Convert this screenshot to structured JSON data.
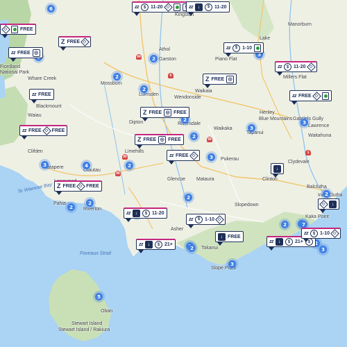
{
  "towns": [
    {
      "name": "Kingston"
    },
    {
      "name": "Manorburn"
    },
    {
      "name": "Lake"
    },
    {
      "name": "Athol"
    },
    {
      "name": "Garston"
    },
    {
      "name": "Piano Flat"
    },
    {
      "name": "Fiordland"
    },
    {
      "name": "National Park"
    },
    {
      "name": "Whare Creek"
    },
    {
      "name": "Mossburn"
    },
    {
      "name": "Lumsden"
    },
    {
      "name": "Waikaia"
    },
    {
      "name": "Wendonside"
    },
    {
      "name": "Millers Flat"
    },
    {
      "name": "Blackmount"
    },
    {
      "name": "Henley"
    },
    {
      "name": "Waiau"
    },
    {
      "name": "Blue Mountains"
    },
    {
      "name": "Gabriels Gully"
    },
    {
      "name": "Lawrence"
    },
    {
      "name": "Dipton"
    },
    {
      "name": "Riversdale"
    },
    {
      "name": "Waikaka"
    },
    {
      "name": "Tapanui"
    },
    {
      "name": "Waitahuna"
    },
    {
      "name": "Clifden"
    },
    {
      "name": "Limehills"
    },
    {
      "name": "Pukerau"
    },
    {
      "name": "Clydevale"
    },
    {
      "name": "Tuatapere"
    },
    {
      "name": "Otautau"
    },
    {
      "name": "Clinton"
    },
    {
      "name": "Balclutha"
    },
    {
      "name": "Longwood"
    },
    {
      "name": "Glencoe"
    },
    {
      "name": "Mataura"
    },
    {
      "name": "Inch Clutha"
    },
    {
      "name": "Pahia"
    },
    {
      "name": "Riverton"
    },
    {
      "name": "Slopedown"
    },
    {
      "name": "Kaka Point"
    },
    {
      "name": "Asher"
    },
    {
      "name": "Tokanui"
    },
    {
      "name": "Slope Point"
    },
    {
      "name": "Oban"
    },
    {
      "name": "Stewart Island"
    },
    {
      "name": "Stewart Island / Rakiura"
    }
  ],
  "water_labels": [
    {
      "name": "Te Waewae Bay"
    },
    {
      "name": "Foveaux Strait"
    }
  ],
  "road_numbers": [
    "94",
    "6",
    "90",
    "96",
    "99",
    "1"
  ],
  "clusters": [
    "6",
    "5",
    "2",
    "2",
    "2",
    "2",
    "2",
    "3",
    "3",
    "3",
    "3",
    "3",
    "2",
    "2",
    "2",
    "3",
    "4",
    "2",
    "5",
    "2",
    "5",
    "2",
    "3",
    "2",
    "2",
    "7",
    "2",
    "3"
  ],
  "badges": [
    {
      "parts": [
        {
          "t": "zz",
          "v": "zz"
        },
        {
          "t": "coin",
          "v": "$"
        },
        {
          "t": "text",
          "v": "11-20"
        },
        {
          "t": "diamond",
          "v": "◇"
        },
        {
          "t": "green"
        },
        {
          "t": "coinsq",
          "v": "$"
        }
      ],
      "magenta": true
    },
    {
      "parts": [
        {
          "t": "diamond",
          "v": "◇"
        },
        {
          "t": "green"
        },
        {
          "t": "text",
          "v": "FREE"
        }
      ],
      "magenta": true
    },
    {
      "parts": [
        {
          "t": "zz",
          "v": "zz"
        },
        {
          "t": "text",
          "v": "FREE"
        },
        {
          "t": "shower",
          "v": "◎"
        }
      ]
    },
    {
      "parts": [
        {
          "t": "z",
          "v": "Z"
        },
        {
          "t": "text",
          "v": "FREE"
        },
        {
          "t": "diamond",
          "v": "◇"
        }
      ],
      "magenta": true
    },
    {
      "parts": [
        {
          "t": "zz",
          "v": "zz"
        },
        {
          "t": "text",
          "v": "FREE"
        }
      ]
    },
    {
      "parts": [
        {
          "t": "zz",
          "v": "zz"
        },
        {
          "t": "drop",
          "v": "↓"
        },
        {
          "t": "coin",
          "v": "$"
        },
        {
          "t": "text",
          "v": "11-20"
        }
      ]
    },
    {
      "parts": [
        {
          "t": "zz",
          "v": "zz"
        },
        {
          "t": "coin",
          "v": "$"
        },
        {
          "t": "text",
          "v": "1-10"
        },
        {
          "t": "green"
        }
      ]
    },
    {
      "parts": [
        {
          "t": "zz",
          "v": "zz"
        },
        {
          "t": "coin",
          "v": "$"
        },
        {
          "t": "text",
          "v": "11-20"
        },
        {
          "t": "diamond",
          "v": "◇"
        }
      ],
      "magenta": true
    },
    {
      "parts": [
        {
          "t": "z",
          "v": "Z"
        },
        {
          "t": "text",
          "v": "FREE"
        },
        {
          "t": "shower",
          "v": "◎"
        },
        {
          "t": "text",
          "v": "FREE"
        }
      ]
    },
    {
      "parts": [
        {
          "t": "zz",
          "v": "zz"
        },
        {
          "t": "text",
          "v": "FREE"
        },
        {
          "t": "diamond",
          "v": "◇"
        },
        {
          "t": "green"
        }
      ]
    },
    {
      "parts": [
        {
          "t": "zz",
          "v": "zz"
        },
        {
          "t": "coin",
          "v": "$"
        },
        {
          "t": "text",
          "v": "1-10"
        },
        {
          "t": "diamond",
          "v": "◇"
        }
      ]
    },
    {
      "parts": [
        {
          "t": "z",
          "v": "Z"
        },
        {
          "t": "text",
          "v": "FREE"
        },
        {
          "t": "shower",
          "v": "◎"
        }
      ]
    },
    {
      "parts": [
        {
          "t": "zz",
          "v": "zz"
        },
        {
          "t": "text",
          "v": "FREE"
        },
        {
          "t": "diamond",
          "v": "◇"
        },
        {
          "t": "text",
          "v": "FREE"
        }
      ],
      "magenta": true
    },
    {
      "parts": [
        {
          "t": "z",
          "v": "Z"
        },
        {
          "t": "text",
          "v": "FREE"
        },
        {
          "t": "shower",
          "v": "◎"
        },
        {
          "t": "text",
          "v": "FREE"
        }
      ],
      "magenta": true
    },
    {
      "parts": [
        {
          "t": "zz",
          "v": "zz"
        },
        {
          "t": "text",
          "v": "FREE"
        },
        {
          "t": "diamond",
          "v": "◇"
        }
      ]
    },
    {
      "parts": [
        {
          "t": "drop",
          "v": "↓"
        }
      ]
    },
    {
      "parts": [
        {
          "t": "z",
          "v": "Z"
        },
        {
          "t": "text",
          "v": "FREE"
        },
        {
          "t": "diamond",
          "v": "◇"
        },
        {
          "t": "text",
          "v": "FREE"
        }
      ],
      "magenta": true
    },
    {
      "parts": [
        {
          "t": "diamond",
          "v": "◇"
        },
        {
          "t": "drop",
          "v": "↓"
        }
      ]
    },
    {
      "parts": [
        {
          "t": "zz",
          "v": "zz"
        },
        {
          "t": "drop",
          "v": "↓"
        },
        {
          "t": "coin",
          "v": "$"
        },
        {
          "t": "text",
          "v": "11-20"
        }
      ],
      "magenta": true
    },
    {
      "parts": [
        {
          "t": "zz",
          "v": "zz"
        },
        {
          "t": "coin",
          "v": "$"
        },
        {
          "t": "text",
          "v": "1-10"
        },
        {
          "t": "diamond",
          "v": "◇"
        }
      ]
    },
    {
      "parts": [
        {
          "t": "drop",
          "v": "↓"
        },
        {
          "t": "text",
          "v": "FREE"
        }
      ]
    },
    {
      "parts": [
        {
          "t": "zz",
          "v": "zz"
        },
        {
          "t": "drop",
          "v": "↓"
        },
        {
          "t": "coin",
          "v": "$"
        },
        {
          "t": "text",
          "v": "21+"
        }
      ],
      "magenta": true
    },
    {
      "parts": [
        {
          "t": "zz",
          "v": "zz"
        },
        {
          "t": "drop",
          "v": "↓"
        },
        {
          "t": "coin",
          "v": "$"
        },
        {
          "t": "text",
          "v": "21+"
        },
        {
          "t": "coin",
          "v": "$"
        }
      ],
      "magenta": true
    },
    {
      "parts": [
        {
          "t": "zz",
          "v": "zz"
        },
        {
          "t": "coin",
          "v": "$"
        },
        {
          "t": "text",
          "v": "1-10"
        },
        {
          "t": "diamond",
          "v": "◇"
        }
      ],
      "magenta": true
    },
    {
      "parts": [
        {
          "t": "zz",
          "v": "zz"
        }
      ]
    }
  ]
}
